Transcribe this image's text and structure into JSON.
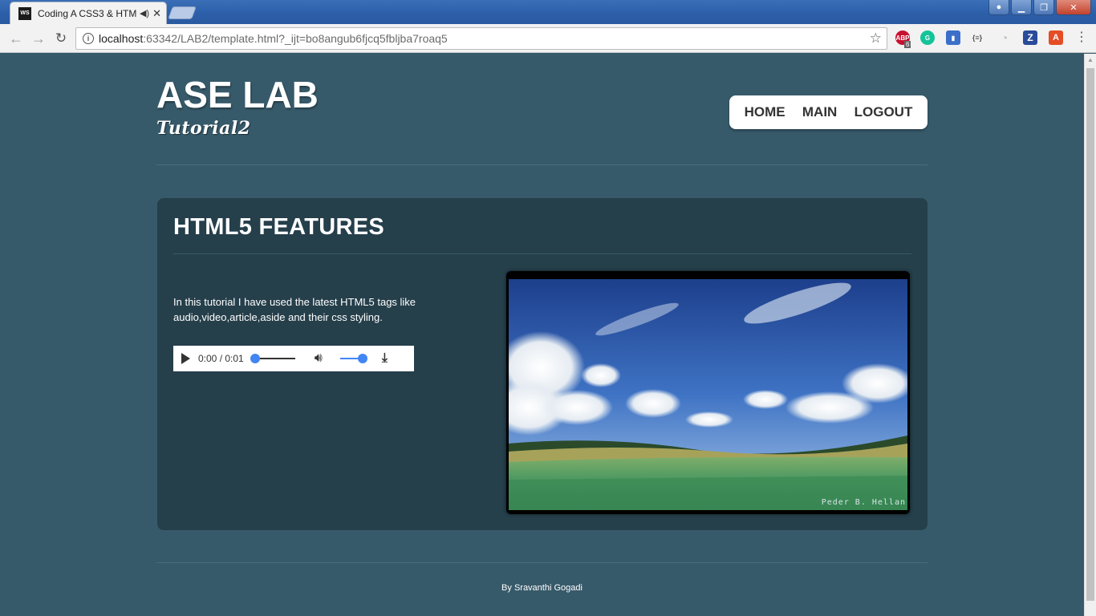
{
  "browser": {
    "tab_title": "Coding A CSS3 & HTM",
    "tab_icon": "WS",
    "audio_indicator": "speaker-icon",
    "url_host": "localhost",
    "url_rest": ":63342/LAB2/template.html?_ijt=bo8angub6fjcq5fbljba7roaq5",
    "extensions": [
      "ABP",
      "G",
      "bookmark",
      "{≡}",
      "ghost",
      "Z",
      "A"
    ],
    "abp_count": "6"
  },
  "header": {
    "title": "ASE LAB",
    "subtitle": "Tutorial2"
  },
  "nav": {
    "items": [
      {
        "label": "HOME"
      },
      {
        "label": "MAIN"
      },
      {
        "label": "LOGOUT"
      }
    ]
  },
  "article": {
    "title": "HTML5 FEATURES",
    "text": "In this tutorial I have used the latest HTML5 tags like audio,video,article,aside and their css styling.",
    "audio": {
      "time": "0:00 / 0:01",
      "progress": 0,
      "volume": 1
    },
    "video": {
      "watermark": "Peder B. Hellan"
    }
  },
  "footer": {
    "text": "By Sravanthi Gogadi"
  },
  "colors": {
    "page_bg": "#375a6a",
    "article_bg": "#253f4b",
    "accent": "#4285f4"
  }
}
